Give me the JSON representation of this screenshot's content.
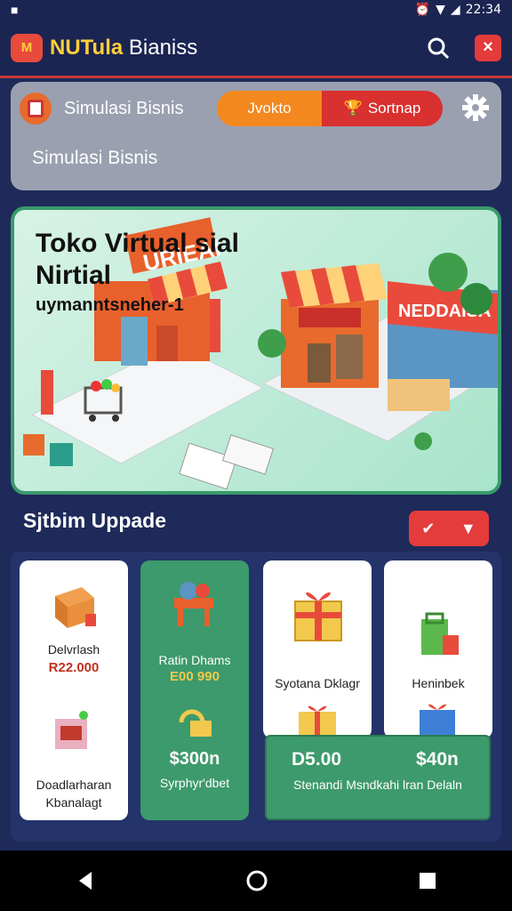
{
  "status": {
    "time": "22:34"
  },
  "appbar": {
    "logo": "M",
    "title_a": "NUTula",
    "title_b": " Bianiss"
  },
  "sim": {
    "label": "Simulasi Bisnis",
    "toggle_a": "Jvokto",
    "toggle_b": "Sortnap",
    "subtitle": "Simulasi Bisnis"
  },
  "hero": {
    "title1": "Toko Virtual sial",
    "title2": "Nirtial",
    "subtitle": "uymanntsneher-1",
    "sign1": "URIEAI",
    "sign2": "NEDDAISA"
  },
  "upgrade": {
    "title": "Sjtbim Uppade"
  },
  "cards": {
    "c1": {
      "label": "Delvrlash",
      "price": "R22.000"
    },
    "c1b": {
      "label1": "Doadlarharan",
      "label2": "Kbanalagt"
    },
    "c2": {
      "label": "Ratin Dhams",
      "price": "E00 990"
    },
    "c2b": {
      "price": "$300n",
      "label": "Syrphyr'dbet"
    },
    "c3": {
      "label": "Syotana Dklagr"
    },
    "c4": {
      "label": "Heninbek"
    },
    "bar": {
      "p1": "D5.00",
      "p2": "$40n",
      "label": "Stenandi Msndkahi lran Delaln"
    }
  },
  "colors": {
    "accent": "#e43b3b",
    "orange": "#f3881f",
    "green": "#3d9a6c",
    "navy": "#1e2a5a"
  }
}
